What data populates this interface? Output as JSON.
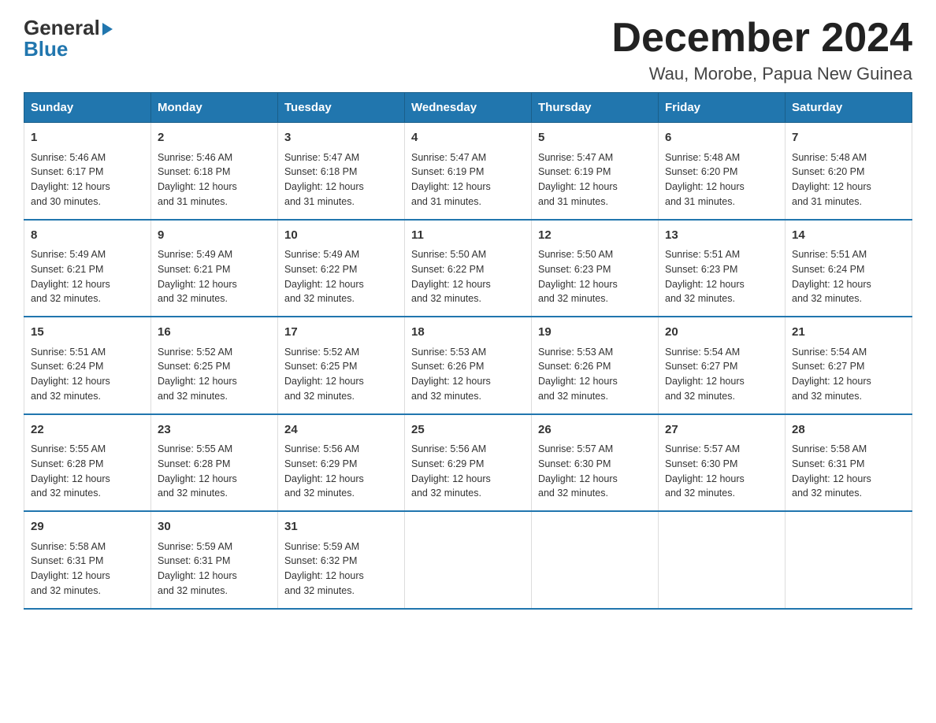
{
  "header": {
    "logo_text_main": "General",
    "logo_text_accent": "Blue",
    "month_title": "December 2024",
    "location": "Wau, Morobe, Papua New Guinea"
  },
  "weekdays": [
    "Sunday",
    "Monday",
    "Tuesday",
    "Wednesday",
    "Thursday",
    "Friday",
    "Saturday"
  ],
  "weeks": [
    [
      {
        "day": "1",
        "sunrise": "5:46 AM",
        "sunset": "6:17 PM",
        "daylight": "12 hours and 30 minutes."
      },
      {
        "day": "2",
        "sunrise": "5:46 AM",
        "sunset": "6:18 PM",
        "daylight": "12 hours and 31 minutes."
      },
      {
        "day": "3",
        "sunrise": "5:47 AM",
        "sunset": "6:18 PM",
        "daylight": "12 hours and 31 minutes."
      },
      {
        "day": "4",
        "sunrise": "5:47 AM",
        "sunset": "6:19 PM",
        "daylight": "12 hours and 31 minutes."
      },
      {
        "day": "5",
        "sunrise": "5:47 AM",
        "sunset": "6:19 PM",
        "daylight": "12 hours and 31 minutes."
      },
      {
        "day": "6",
        "sunrise": "5:48 AM",
        "sunset": "6:20 PM",
        "daylight": "12 hours and 31 minutes."
      },
      {
        "day": "7",
        "sunrise": "5:48 AM",
        "sunset": "6:20 PM",
        "daylight": "12 hours and 31 minutes."
      }
    ],
    [
      {
        "day": "8",
        "sunrise": "5:49 AM",
        "sunset": "6:21 PM",
        "daylight": "12 hours and 32 minutes."
      },
      {
        "day": "9",
        "sunrise": "5:49 AM",
        "sunset": "6:21 PM",
        "daylight": "12 hours and 32 minutes."
      },
      {
        "day": "10",
        "sunrise": "5:49 AM",
        "sunset": "6:22 PM",
        "daylight": "12 hours and 32 minutes."
      },
      {
        "day": "11",
        "sunrise": "5:50 AM",
        "sunset": "6:22 PM",
        "daylight": "12 hours and 32 minutes."
      },
      {
        "day": "12",
        "sunrise": "5:50 AM",
        "sunset": "6:23 PM",
        "daylight": "12 hours and 32 minutes."
      },
      {
        "day": "13",
        "sunrise": "5:51 AM",
        "sunset": "6:23 PM",
        "daylight": "12 hours and 32 minutes."
      },
      {
        "day": "14",
        "sunrise": "5:51 AM",
        "sunset": "6:24 PM",
        "daylight": "12 hours and 32 minutes."
      }
    ],
    [
      {
        "day": "15",
        "sunrise": "5:51 AM",
        "sunset": "6:24 PM",
        "daylight": "12 hours and 32 minutes."
      },
      {
        "day": "16",
        "sunrise": "5:52 AM",
        "sunset": "6:25 PM",
        "daylight": "12 hours and 32 minutes."
      },
      {
        "day": "17",
        "sunrise": "5:52 AM",
        "sunset": "6:25 PM",
        "daylight": "12 hours and 32 minutes."
      },
      {
        "day": "18",
        "sunrise": "5:53 AM",
        "sunset": "6:26 PM",
        "daylight": "12 hours and 32 minutes."
      },
      {
        "day": "19",
        "sunrise": "5:53 AM",
        "sunset": "6:26 PM",
        "daylight": "12 hours and 32 minutes."
      },
      {
        "day": "20",
        "sunrise": "5:54 AM",
        "sunset": "6:27 PM",
        "daylight": "12 hours and 32 minutes."
      },
      {
        "day": "21",
        "sunrise": "5:54 AM",
        "sunset": "6:27 PM",
        "daylight": "12 hours and 32 minutes."
      }
    ],
    [
      {
        "day": "22",
        "sunrise": "5:55 AM",
        "sunset": "6:28 PM",
        "daylight": "12 hours and 32 minutes."
      },
      {
        "day": "23",
        "sunrise": "5:55 AM",
        "sunset": "6:28 PM",
        "daylight": "12 hours and 32 minutes."
      },
      {
        "day": "24",
        "sunrise": "5:56 AM",
        "sunset": "6:29 PM",
        "daylight": "12 hours and 32 minutes."
      },
      {
        "day": "25",
        "sunrise": "5:56 AM",
        "sunset": "6:29 PM",
        "daylight": "12 hours and 32 minutes."
      },
      {
        "day": "26",
        "sunrise": "5:57 AM",
        "sunset": "6:30 PM",
        "daylight": "12 hours and 32 minutes."
      },
      {
        "day": "27",
        "sunrise": "5:57 AM",
        "sunset": "6:30 PM",
        "daylight": "12 hours and 32 minutes."
      },
      {
        "day": "28",
        "sunrise": "5:58 AM",
        "sunset": "6:31 PM",
        "daylight": "12 hours and 32 minutes."
      }
    ],
    [
      {
        "day": "29",
        "sunrise": "5:58 AM",
        "sunset": "6:31 PM",
        "daylight": "12 hours and 32 minutes."
      },
      {
        "day": "30",
        "sunrise": "5:59 AM",
        "sunset": "6:31 PM",
        "daylight": "12 hours and 32 minutes."
      },
      {
        "day": "31",
        "sunrise": "5:59 AM",
        "sunset": "6:32 PM",
        "daylight": "12 hours and 32 minutes."
      },
      null,
      null,
      null,
      null
    ]
  ],
  "labels": {
    "sunrise": "Sunrise:",
    "sunset": "Sunset:",
    "daylight": "Daylight:"
  }
}
